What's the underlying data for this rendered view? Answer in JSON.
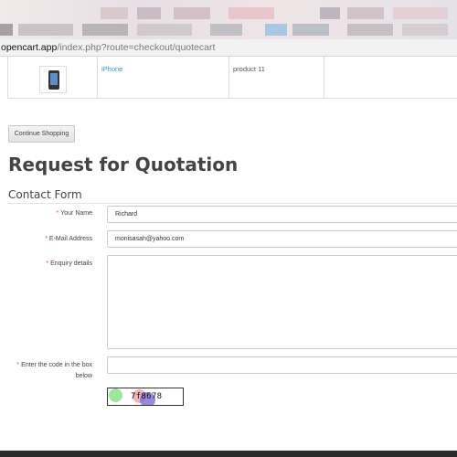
{
  "browser": {
    "url_host": "opencart.app",
    "url_path": "/index.php?route=checkout/quotecart"
  },
  "cart": {
    "rows": [
      {
        "product_name": "iPhone",
        "model": "product 11"
      }
    ]
  },
  "buttons": {
    "continue_shopping": "Continue Shopping"
  },
  "page": {
    "title": "Request for Quotation",
    "legend": "Contact Form"
  },
  "form": {
    "name": {
      "label": "Your Name",
      "value": "Richard"
    },
    "email": {
      "label": "E-Mail Address",
      "value": "monisasah@yahoo.com"
    },
    "enquiry": {
      "label": "Enquiry details",
      "value": ""
    },
    "captcha": {
      "label": "Enter the code in the box below",
      "value": "",
      "code": "7f8678"
    }
  },
  "colors": {
    "link": "#2a9fd6",
    "required_star": "#e3503e",
    "footer": "#2b2b2b"
  }
}
